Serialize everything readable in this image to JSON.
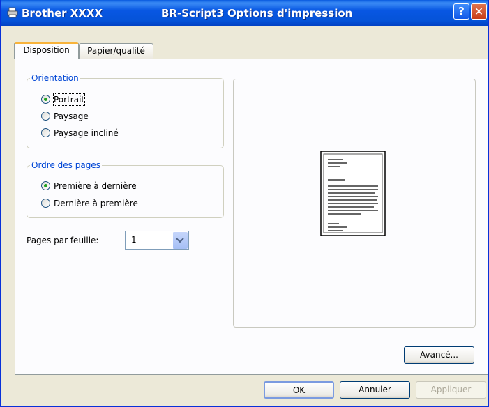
{
  "titlebar": {
    "title_left": "Brother XXXX",
    "title_right": "BR-Script3 Options d'impression",
    "help_label": "?",
    "close_label": "✕"
  },
  "tabs": [
    {
      "label": "Disposition",
      "active": true
    },
    {
      "label": "Papier/qualité",
      "active": false
    }
  ],
  "orientation": {
    "label": "Orientation",
    "options": [
      {
        "label": "Portrait",
        "selected": true
      },
      {
        "label": "Paysage",
        "selected": false
      },
      {
        "label": "Paysage incliné",
        "selected": false
      }
    ]
  },
  "page_order": {
    "label": "Ordre des pages",
    "options": [
      {
        "label": "Première à dernière",
        "selected": true
      },
      {
        "label": "Dernière à première",
        "selected": false
      }
    ]
  },
  "pages_per_sheet": {
    "label": "Pages par feuille:",
    "value": "1"
  },
  "buttons": {
    "advanced": "Avancé...",
    "ok": "OK",
    "cancel": "Annuler",
    "apply": "Appliquer"
  },
  "colors": {
    "titlebar": "#0857e3",
    "group_label": "#0046d5",
    "tab_highlight": "#f8b33b",
    "radio_dot": "#21a121"
  }
}
